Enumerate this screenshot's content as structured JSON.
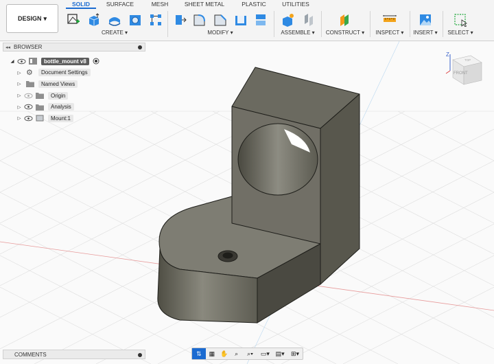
{
  "workspace": {
    "label": "DESIGN",
    "caret": "▾"
  },
  "tabs": [
    {
      "label": "SOLID",
      "active": true
    },
    {
      "label": "SURFACE"
    },
    {
      "label": "MESH"
    },
    {
      "label": "SHEET METAL"
    },
    {
      "label": "PLASTIC"
    },
    {
      "label": "UTILITIES"
    }
  ],
  "groups": {
    "create": "CREATE ▾",
    "modify": "MODIFY ▾",
    "assemble": "ASSEMBLE ▾",
    "construct": "CONSTRUCT ▾",
    "inspect": "INSPECT ▾",
    "insert": "INSERT ▾",
    "select": "SELECT ▾"
  },
  "browser": {
    "title": "BROWSER",
    "items": [
      {
        "label": "bottle_mount v8",
        "icon": "component-icon",
        "eye": true,
        "root": true
      },
      {
        "label": "Document Settings",
        "icon": "gear-icon",
        "eye": false
      },
      {
        "label": "Named Views",
        "icon": "folder-icon",
        "eye": false
      },
      {
        "label": "Origin",
        "icon": "folder-icon",
        "eye": true,
        "hidden": true
      },
      {
        "label": "Analysis",
        "icon": "folder-icon",
        "eye": true
      },
      {
        "label": "Mount:1",
        "icon": "body-icon",
        "eye": true
      }
    ]
  },
  "viewcube": {
    "axis": "Z",
    "front": "FRONT",
    "top": "TOP"
  },
  "comments": {
    "title": "COMMENTS"
  },
  "colors": {
    "accent": "#1b6bd1",
    "model_face": "#76756b",
    "grid": "#d9d9d9"
  }
}
